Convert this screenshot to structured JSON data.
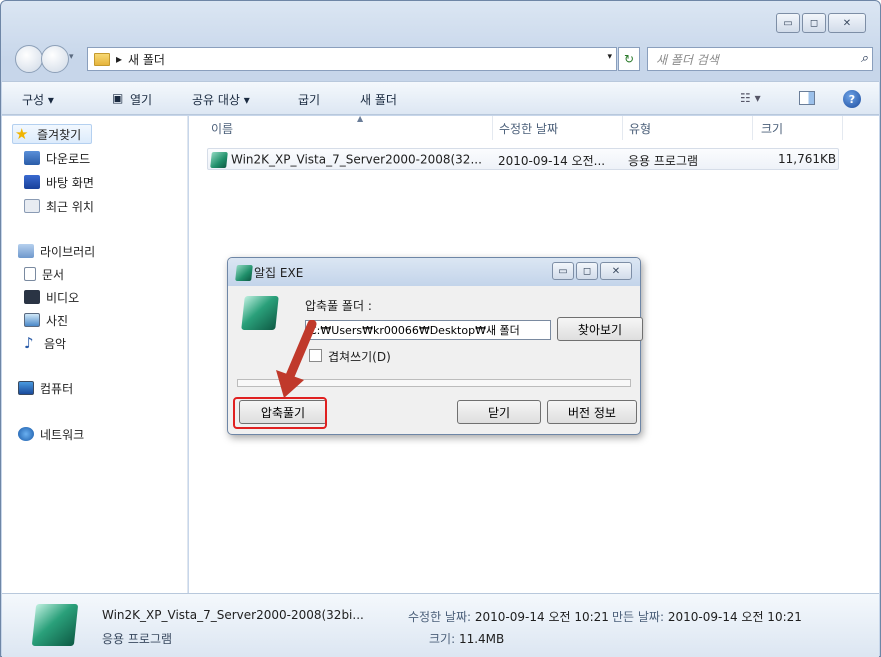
{
  "window": {
    "minimize": "▭",
    "maximize": "◻",
    "close": "✕"
  },
  "address": {
    "separator": "▸",
    "path": "새 폴더",
    "search_placeholder": "새 폴더 검색"
  },
  "toolbar": {
    "organize": "구성 ▾",
    "open": "열기",
    "share": "공유 대상 ▾",
    "burn": "굽기",
    "new_folder": "새 폴더"
  },
  "sidebar": {
    "favorites": "즐겨찾기",
    "downloads": "다운로드",
    "desktop": "바탕 화면",
    "recent": "최근 위치",
    "libraries": "라이브러리",
    "documents": "문서",
    "videos": "비디오",
    "pictures": "사진",
    "music": "음악",
    "computer": "컴퓨터",
    "network": "네트워크"
  },
  "columns": {
    "name": "이름",
    "modified": "수정한 날짜",
    "type": "유형",
    "size": "크기"
  },
  "file": {
    "name": "Win2K_XP_Vista_7_Server2000-2008(32...",
    "modified": "2010-09-14 오전...",
    "type": "응용 프로그램",
    "size": "11,761KB"
  },
  "dialog": {
    "title": "알집 EXE",
    "folder_label": "압축풀 폴더 :",
    "path_value": "C:₩Users₩kr00066₩Desktop₩새 폴더",
    "browse": "찾아보기",
    "overwrite": "겹쳐쓰기(D)",
    "extract": "압축풀기",
    "close": "닫기",
    "version": "버전 정보"
  },
  "details": {
    "name": "Win2K_XP_Vista_7_Server2000-2008(32bi...",
    "type": "응용 프로그램",
    "modified_label": "수정한 날짜:",
    "modified_value": "2010-09-14 오전 10:21",
    "created_label": "만든 날짜:",
    "created_value": "2010-09-14 오전 10:21",
    "size_label": "크기:",
    "size_value": "11.4MB"
  },
  "colors": {
    "highlight": "#e02020",
    "arrow": "#c0392b"
  }
}
